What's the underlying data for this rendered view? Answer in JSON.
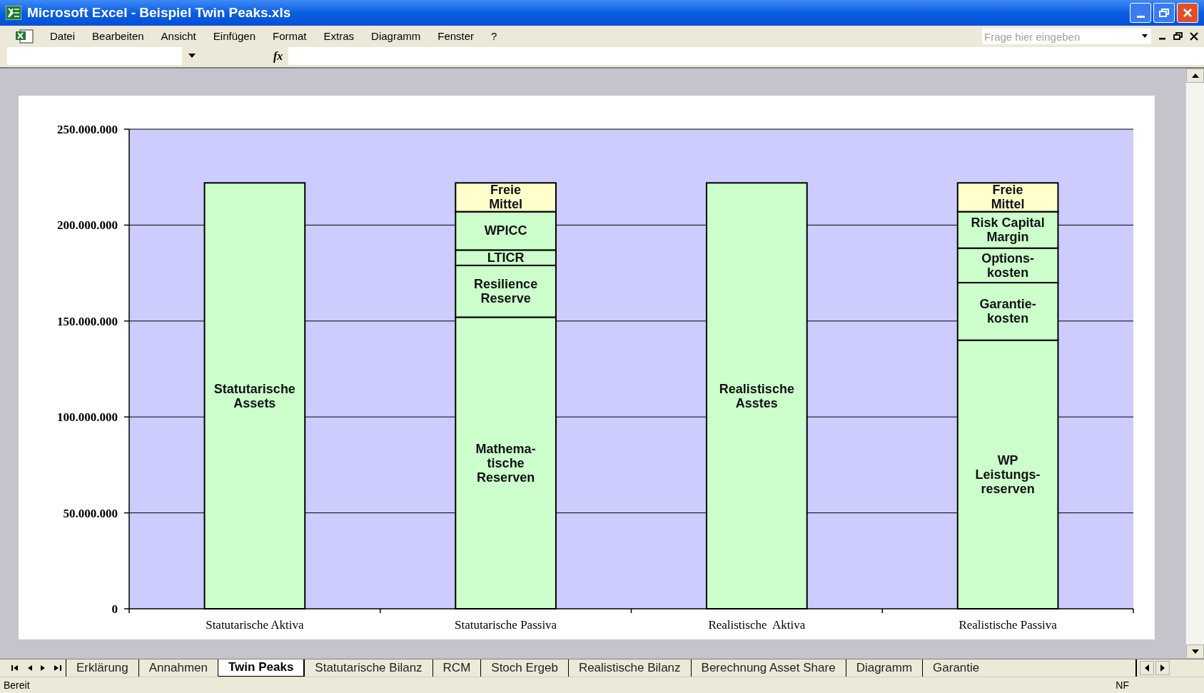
{
  "window": {
    "title": "Microsoft Excel - Beispiel Twin Peaks.xls"
  },
  "menu": [
    "Datei",
    "Bearbeiten",
    "Ansicht",
    "Einfügen",
    "Format",
    "Extras",
    "Diagramm",
    "Fenster",
    "?"
  ],
  "help_search": {
    "placeholder": "Frage hier eingeben"
  },
  "formula_bar": {
    "fx_label": "fx"
  },
  "chart": {
    "chart_data": {
      "type": "bar",
      "stacked": true,
      "categories": [
        "Statutarische Aktiva",
        "Statutarische Passiva",
        "Realistische  Aktiva",
        "Realistische Passiva"
      ],
      "ylim": [
        0,
        250000000
      ],
      "grid": true,
      "yticks": [
        {
          "value": 0,
          "label": "0"
        },
        {
          "value": 50000000,
          "label": "50.000.000"
        },
        {
          "value": 100000000,
          "label": "100.000.000"
        },
        {
          "value": 150000000,
          "label": "150.000.000"
        },
        {
          "value": 200000000,
          "label": "200.000.000"
        },
        {
          "value": 250000000,
          "label": "250.000.000"
        }
      ],
      "series": [
        {
          "name": "Statutarische\nAssets",
          "color": "#ccffcc",
          "values": [
            222000000,
            null,
            null,
            null
          ]
        },
        {
          "name": "Mathema-\ntische\nReserven",
          "color": "#ccffcc",
          "values": [
            null,
            152000000,
            null,
            null
          ]
        },
        {
          "name": "Resilience\nReserve",
          "color": "#ccffcc",
          "values": [
            null,
            27000000,
            null,
            null
          ]
        },
        {
          "name": "LTICR",
          "color": "#ccffcc",
          "values": [
            null,
            8000000,
            null,
            null
          ]
        },
        {
          "name": "WPICC",
          "color": "#ccffcc",
          "values": [
            null,
            20000000,
            null,
            null
          ]
        },
        {
          "name": "Realistische\nAsstes",
          "color": "#ccffcc",
          "values": [
            null,
            null,
            222000000,
            null
          ]
        },
        {
          "name": "WP\nLeistungs-\nreserven",
          "color": "#ccffcc",
          "values": [
            null,
            null,
            null,
            140000000
          ]
        },
        {
          "name": "Garantie-\nkosten",
          "color": "#ccffcc",
          "values": [
            null,
            null,
            null,
            30000000
          ]
        },
        {
          "name": "Options-\nkosten",
          "color": "#ccffcc",
          "values": [
            null,
            null,
            null,
            18000000
          ]
        },
        {
          "name": "Risk Capital\nMargin",
          "color": "#ccffcc",
          "values": [
            null,
            null,
            null,
            19000000
          ]
        },
        {
          "name": "Freie\nMittel",
          "color": "#ffffcc",
          "values": [
            null,
            15000000,
            null,
            15000000
          ]
        }
      ]
    }
  },
  "sheet_tabs": [
    {
      "label": "Erklärung",
      "selected": false
    },
    {
      "label": "Annahmen",
      "selected": false
    },
    {
      "label": "Twin Peaks",
      "selected": true
    },
    {
      "label": "Statutarische Bilanz",
      "selected": false
    },
    {
      "label": "RCM",
      "selected": false
    },
    {
      "label": "Stoch Ergeb",
      "selected": false
    },
    {
      "label": "Realistische Bilanz",
      "selected": false
    },
    {
      "label": "Berechnung Asset Share",
      "selected": false
    },
    {
      "label": "Diagramm",
      "selected": false
    },
    {
      "label": "Garantie",
      "selected": false
    }
  ],
  "status_bar": {
    "left": "Bereit",
    "right": "NF"
  }
}
